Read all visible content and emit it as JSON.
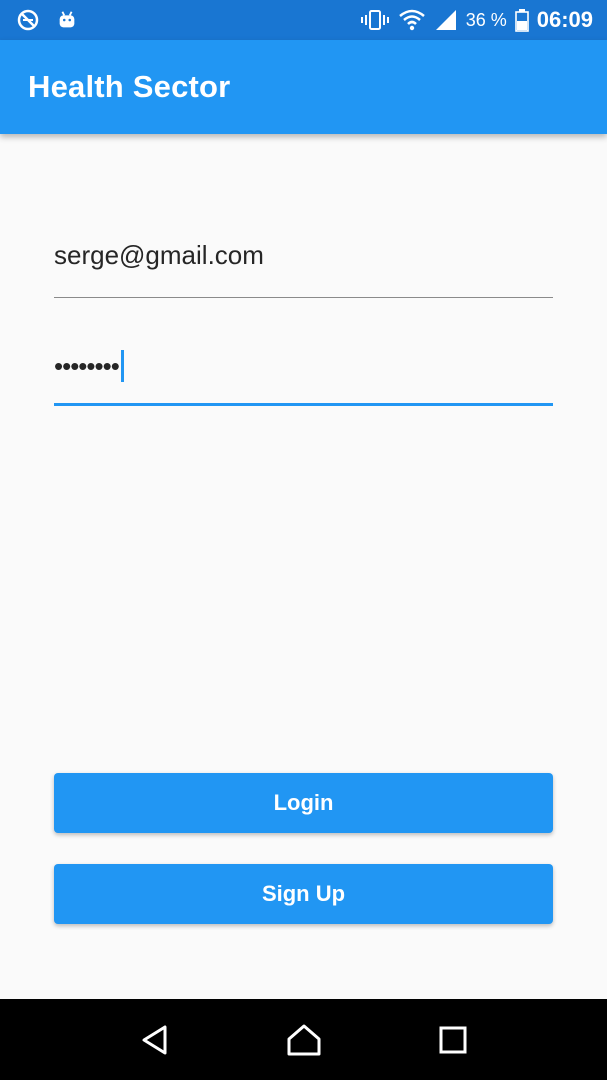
{
  "status_bar": {
    "battery_percent": "36 %",
    "time": "06:09",
    "icons": [
      "data-saver-icon",
      "android-icon",
      "vibrate-icon",
      "wifi-icon",
      "signal-icon",
      "battery-icon"
    ]
  },
  "app_bar": {
    "title": "Health Sector"
  },
  "form": {
    "email_value": "serge@gmail.com",
    "password_masked": "••••••••"
  },
  "buttons": {
    "login_label": "Login",
    "signup_label": "Sign Up"
  },
  "colors": {
    "status_bar": "#1976d2",
    "primary": "#2196f3",
    "background": "#fafafa",
    "nav_bar": "#000000"
  },
  "nav_bar": {
    "icons": [
      "back-icon",
      "home-icon",
      "recents-icon"
    ]
  }
}
